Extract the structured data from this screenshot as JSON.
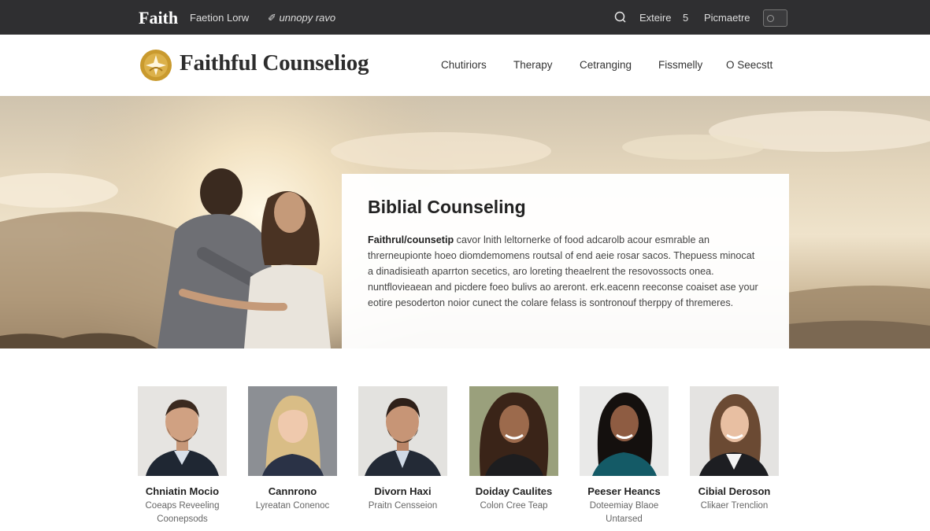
{
  "topbar": {
    "brand": "Faith",
    "link1": "Faetion Lorw",
    "link2": "unnopy ravo",
    "link3": "Exteire",
    "count": "5",
    "link4": "Picmaetre"
  },
  "header": {
    "site_title": "Faithful Counseliog",
    "nav": [
      "Chutiriors",
      "Therapy",
      "Cetranging",
      "Fissmelly",
      "O Seecstt"
    ]
  },
  "hero": {
    "heading": "Biblial Counseling",
    "lead": "Faithrul/counsetip",
    "body": " cavor lnith leltornerke of food adcarolb acour esmrable an threrneupionte hoeo diomdemomens routsal of end aeie rosar sacos. Thepuess minocat a dinadisieath aparrton secetics, aro loreting theaelrent the resovossocts onea. nuntflovieaean and picdere foeo bulivs ao areront. erk.eacenn reeconse coaiset ase your eotire pesoderton noior cunect the colare felass is sontronouf therppy of thremeres."
  },
  "team": [
    {
      "name": "Chniatin Mocio",
      "role": "Coeaps Reveeling Coonepsods"
    },
    {
      "name": "Cannrono",
      "role": "Lyreatan Conenoc"
    },
    {
      "name": "Divorn Haxi",
      "role": "Praitn Censseion"
    },
    {
      "name": "Doiday Caulites",
      "role": "Colon Cree Teap"
    },
    {
      "name": "Peeser Heancs",
      "role": "Doteemiay Blaoe Untarsed"
    },
    {
      "name": "Cibial Deroson",
      "role": "Clikaer Trenclion"
    }
  ]
}
